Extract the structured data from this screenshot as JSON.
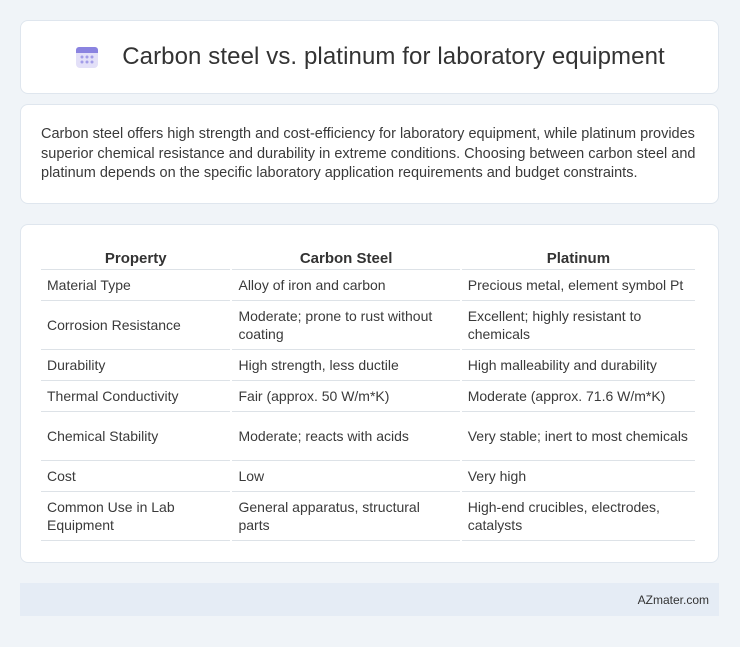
{
  "header": {
    "title": "Carbon steel vs. platinum for laboratory equipment",
    "icon": "calendar-icon",
    "icon_color": "#7b74d9"
  },
  "intro": {
    "text": "Carbon steel offers high strength and cost-efficiency for laboratory equipment, while platinum provides superior chemical resistance and durability in extreme conditions. Choosing between carbon steel and platinum depends on the specific laboratory application requirements and budget constraints."
  },
  "table": {
    "headers": [
      "Property",
      "Carbon Steel",
      "Platinum"
    ],
    "rows": [
      [
        "Material Type",
        "Alloy of iron and carbon",
        "Precious metal, element symbol Pt"
      ],
      [
        "Corrosion Resistance",
        "Moderate; prone to rust without coating",
        "Excellent; highly resistant to chemicals"
      ],
      [
        "Durability",
        "High strength, less ductile",
        "High malleability and durability"
      ],
      [
        "Thermal Conductivity",
        "Fair (approx. 50 W/m*K)",
        "Moderate (approx. 71.6 W/m*K)"
      ],
      [
        "Chemical Stability",
        "Moderate; reacts with acids",
        "Very stable; inert to most chemicals"
      ],
      [
        "Cost",
        "Low",
        "Very high"
      ],
      [
        "Common Use in Lab Equipment",
        "General apparatus, structural parts",
        "High-end crucibles, electrodes, catalysts"
      ]
    ]
  },
  "footer": {
    "text": "AZmater.com"
  }
}
